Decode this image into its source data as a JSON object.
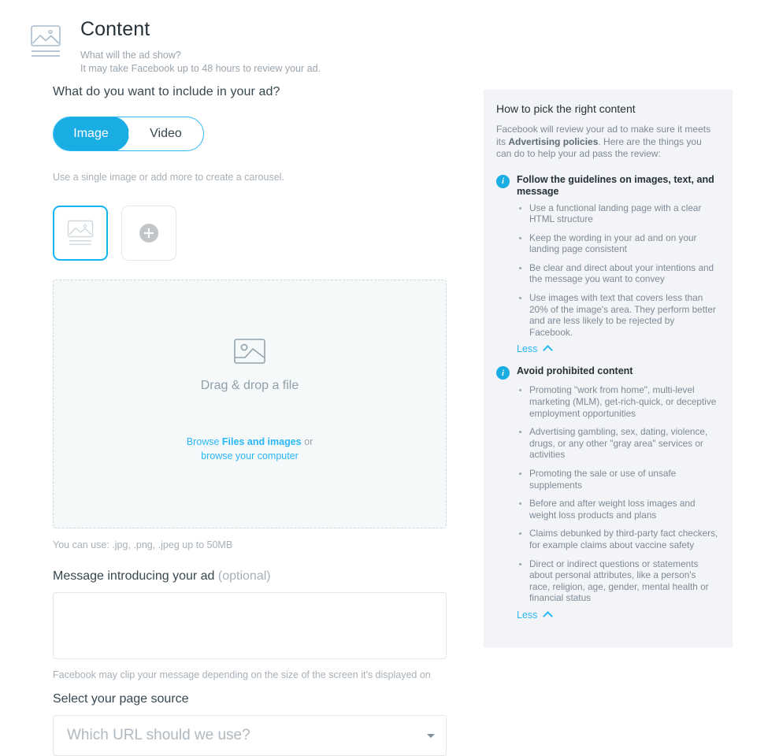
{
  "header": {
    "icon": "image-lines-icon",
    "title": "Content",
    "subtitle_line1": "What will the ad show?",
    "subtitle_line2": "It may take Facebook up to 48 hours to review your ad."
  },
  "colors": {
    "accent_blue": "#1aade4",
    "link_blue": "#29b6f6",
    "panel_bg": "#f3f4f7",
    "dropzone_bg": "#f5f9fa",
    "muted_text": "#a7b0b8"
  },
  "main": {
    "question": "What do you want to include in your ad?",
    "media_type_toggle": {
      "options": [
        "Image",
        "Video"
      ],
      "selected": "Image"
    },
    "toggle_helper": "Use a single image or add more to create a carousel.",
    "thumbnails": [
      {
        "name": "image-thumbnail",
        "selected": true,
        "icon": "image-lines-icon"
      },
      {
        "name": "add-image-thumbnail",
        "selected": false,
        "icon": "plus-icon"
      }
    ],
    "dropzone": {
      "icon": "image-placeholder-icon",
      "label": "Drag & drop a file",
      "browse_prefix": "Browse ",
      "browse_strong": "Files and images",
      "browse_suffix": " or",
      "browse_link": "browse your computer"
    },
    "filetypes_hint": "You can use: .jpg, .png, .jpeg up to 50MB",
    "message_field": {
      "label": "Message introducing your ad ",
      "optional": "(optional)",
      "value": "",
      "placeholder": "",
      "hint": "Facebook may clip your message depending on the size of the screen it's displayed on"
    },
    "page_source": {
      "label": "Select your page source",
      "placeholder": "Which URL should we use?",
      "value": "",
      "caret": "chevron-down-icon"
    }
  },
  "side_panel": {
    "title": "How to pick the right content",
    "intro_part1": "Facebook will review your ad to make sure it meets its ",
    "intro_strong": "Advertising policies",
    "intro_part2": ". Here are the things you can do to help your ad pass the review:",
    "sections": [
      {
        "icon": "info-icon",
        "title": "Follow the guidelines on images, text, and message",
        "bullets": [
          "Use a functional landing page with a clear HTML structure",
          "Keep the wording in your ad and on your landing page consistent",
          "Be clear and direct about your intentions and the message you want to convey",
          "Use images with text that covers less than 20% of the image's area. They perform better and are less likely to be rejected by Facebook."
        ],
        "toggle_label": "Less",
        "toggle_icon": "chevron-up-icon"
      },
      {
        "icon": "info-icon",
        "title": "Avoid prohibited content",
        "bullets": [
          "Promoting \"work from home\", multi-level marketing (MLM), get-rich-quick, or deceptive employment opportunities",
          "Advertising gambling, sex, dating, violence, drugs, or any other \"gray area\" services or activities",
          "Promoting the sale or use of unsafe supplements",
          "Before and after weight loss images and weight loss products and plans",
          "Claims debunked by third-party fact checkers, for example claims about vaccine safety",
          "Direct or indirect questions or statements about personal attributes, like a person's race, religion, age, gender, mental health or financial status"
        ],
        "toggle_label": "Less",
        "toggle_icon": "chevron-up-icon"
      }
    ]
  }
}
